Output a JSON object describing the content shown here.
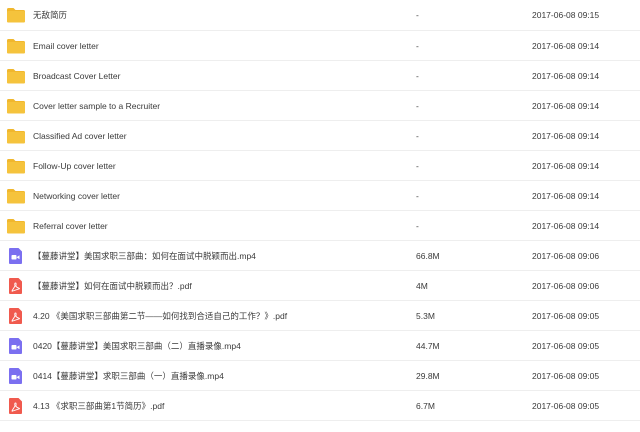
{
  "files": [
    {
      "type": "folder",
      "icon": "folder-icon",
      "name": "无敌简历",
      "size": "-",
      "date": "2017-06-08 09:15"
    },
    {
      "type": "folder",
      "icon": "folder-icon",
      "name": "Email cover letter",
      "size": "-",
      "date": "2017-06-08 09:14"
    },
    {
      "type": "folder",
      "icon": "folder-icon",
      "name": "Broadcast Cover Letter",
      "size": "-",
      "date": "2017-06-08 09:14"
    },
    {
      "type": "folder",
      "icon": "folder-icon",
      "name": "Cover letter sample to a Recruiter",
      "size": "-",
      "date": "2017-06-08 09:14"
    },
    {
      "type": "folder",
      "icon": "folder-icon",
      "name": "Classified Ad cover letter",
      "size": "-",
      "date": "2017-06-08 09:14"
    },
    {
      "type": "folder",
      "icon": "folder-icon",
      "name": "Follow-Up cover letter",
      "size": "-",
      "date": "2017-06-08 09:14"
    },
    {
      "type": "folder",
      "icon": "folder-icon",
      "name": "Networking cover letter",
      "size": "-",
      "date": "2017-06-08 09:14"
    },
    {
      "type": "folder",
      "icon": "folder-icon",
      "name": "Referral cover letter",
      "size": "-",
      "date": "2017-06-08 09:14"
    },
    {
      "type": "video",
      "icon": "video-file-icon",
      "name": "【蔓藤讲堂】美国求职三部曲：如何在面试中脱颖而出.mp4",
      "size": "66.8M",
      "date": "2017-06-08 09:06"
    },
    {
      "type": "pdf",
      "icon": "pdf-file-icon",
      "name": "【蔓藤讲堂】如何在面试中脱颖而出？.pdf",
      "size": "4M",
      "date": "2017-06-08 09:06"
    },
    {
      "type": "pdf",
      "icon": "pdf-file-icon",
      "name": "4.20 《美国求职三部曲第二节——如何找到合适自己的工作？》.pdf",
      "size": "5.3M",
      "date": "2017-06-08 09:05"
    },
    {
      "type": "video",
      "icon": "video-file-icon",
      "name": "0420【蔓藤讲堂】美国求职三部曲（二）直播录像.mp4",
      "size": "44.7M",
      "date": "2017-06-08 09:05"
    },
    {
      "type": "video",
      "icon": "video-file-icon",
      "name": "0414【蔓藤讲堂】求职三部曲（一）直播录像.mp4",
      "size": "29.8M",
      "date": "2017-06-08 09:05"
    },
    {
      "type": "pdf",
      "icon": "pdf-file-icon",
      "name": "4.13 《求职三部曲第1节简历》.pdf",
      "size": "6.7M",
      "date": "2017-06-08 09:05"
    }
  ],
  "colors": {
    "folder": "#f5c33c",
    "folder_tab": "#f0b72d",
    "video": "#7b6ff0",
    "pdf": "#f05a4e"
  }
}
